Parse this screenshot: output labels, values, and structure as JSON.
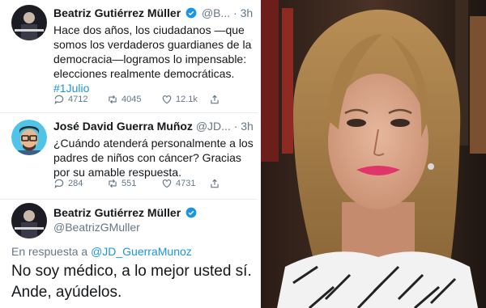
{
  "tweet1": {
    "name": "Beatriz Gutiérrez Müller",
    "handle": "@B...",
    "time": "· 3h",
    "lines": [
      "Hace dos años, los ciudadanos —que",
      "somos los verdaderos guardianes de la",
      "democracia—logramos lo impensable:",
      "elecciones realmente democráticas."
    ],
    "hashtag": "#1Julio",
    "replies": "4712",
    "retweets": "4045",
    "likes": "12.1k"
  },
  "tweet2": {
    "name": "José David Guerra Muñoz",
    "handle": "@JD...",
    "time": "· 3h",
    "lines": [
      "¿Cuándo atenderá personalmente a los",
      "padres de niños con cáncer? Gracias",
      "por su amable respuesta."
    ],
    "replies": "284",
    "retweets": "551",
    "likes": "4731"
  },
  "tweet3": {
    "name": "Beatriz Gutiérrez Müller",
    "handle": "@BeatrizGMuller",
    "reply_prefix": "En respuesta a",
    "reply_to": "@JD_GuerraMunoz",
    "lines": [
      "No soy médico, a lo mejor usted sí.",
      "Ande, ayúdelos."
    ]
  },
  "colors": {
    "link": "#1b95e0",
    "muted": "#657786",
    "text": "#14171a",
    "lipstick": "#e0356a"
  }
}
